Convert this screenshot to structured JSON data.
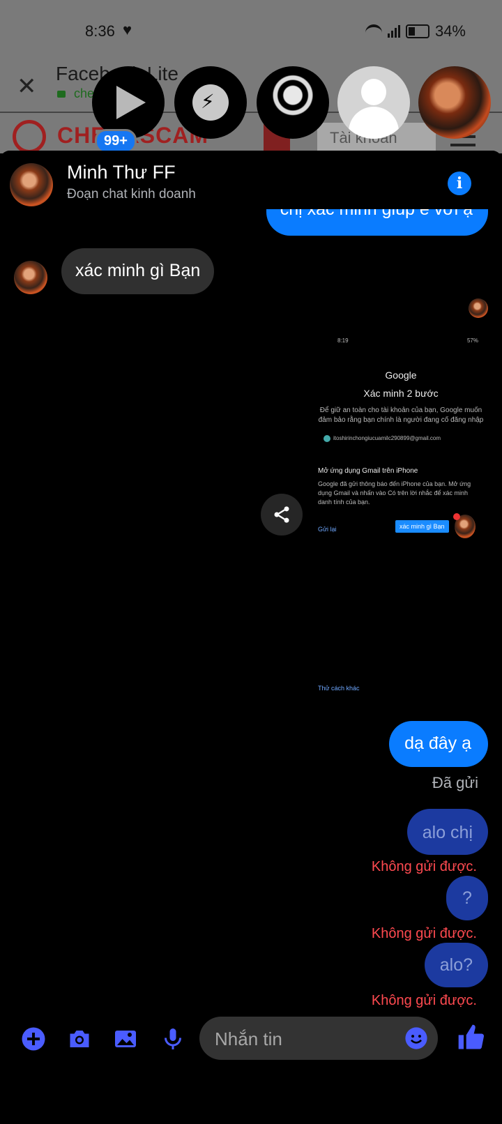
{
  "status_bar": {
    "time": "8:36",
    "battery": "34%"
  },
  "browser": {
    "title": "Facebook Lite",
    "url": "checkscam",
    "site_logo_text": "CHECKSCAM",
    "account_button": "Tài khoản"
  },
  "chat_heads": {
    "badge": "99+"
  },
  "chat": {
    "contact_name": "Minh Thư FF",
    "contact_subtitle": "Đoạn chat kinh doanh",
    "messages": {
      "m1": "chị xác minh giúp e với ạ",
      "m2": "xác minh gì Bạn",
      "m3": "dạ đây ạ",
      "m4": "alo chị",
      "m5": "?",
      "m6": "alo?"
    },
    "sent_status": "Đã gửi",
    "failed_status": "Không gửi được."
  },
  "screenshot_content": {
    "time": "8:19",
    "battery": "57%",
    "google": "Google",
    "title": "Xác minh 2 bước",
    "description": "Để giữ an toàn cho tài khoản của bạn, Google muốn đảm bảo rằng bạn chính là người đang cố đăng nhập",
    "email": "itoshirinchongiucuamilc290899@gmail.com",
    "open_app": "Mở ứng dụng Gmail trên iPhone",
    "body": "Google đã gửi thông báo đến iPhone của bạn. Mở ứng dụng Gmail và nhấn vào Có trên lời nhắc để xác minh danh tính của bạn.",
    "resend": "Gửi lại",
    "notification": "xác minh gì Bạn",
    "other_way": "Thử cách khác"
  },
  "composer": {
    "placeholder": "Nhắn tin"
  },
  "colors": {
    "accent": "#0a7cff",
    "error": "#ff4a50",
    "icon": "#4a5cff"
  }
}
